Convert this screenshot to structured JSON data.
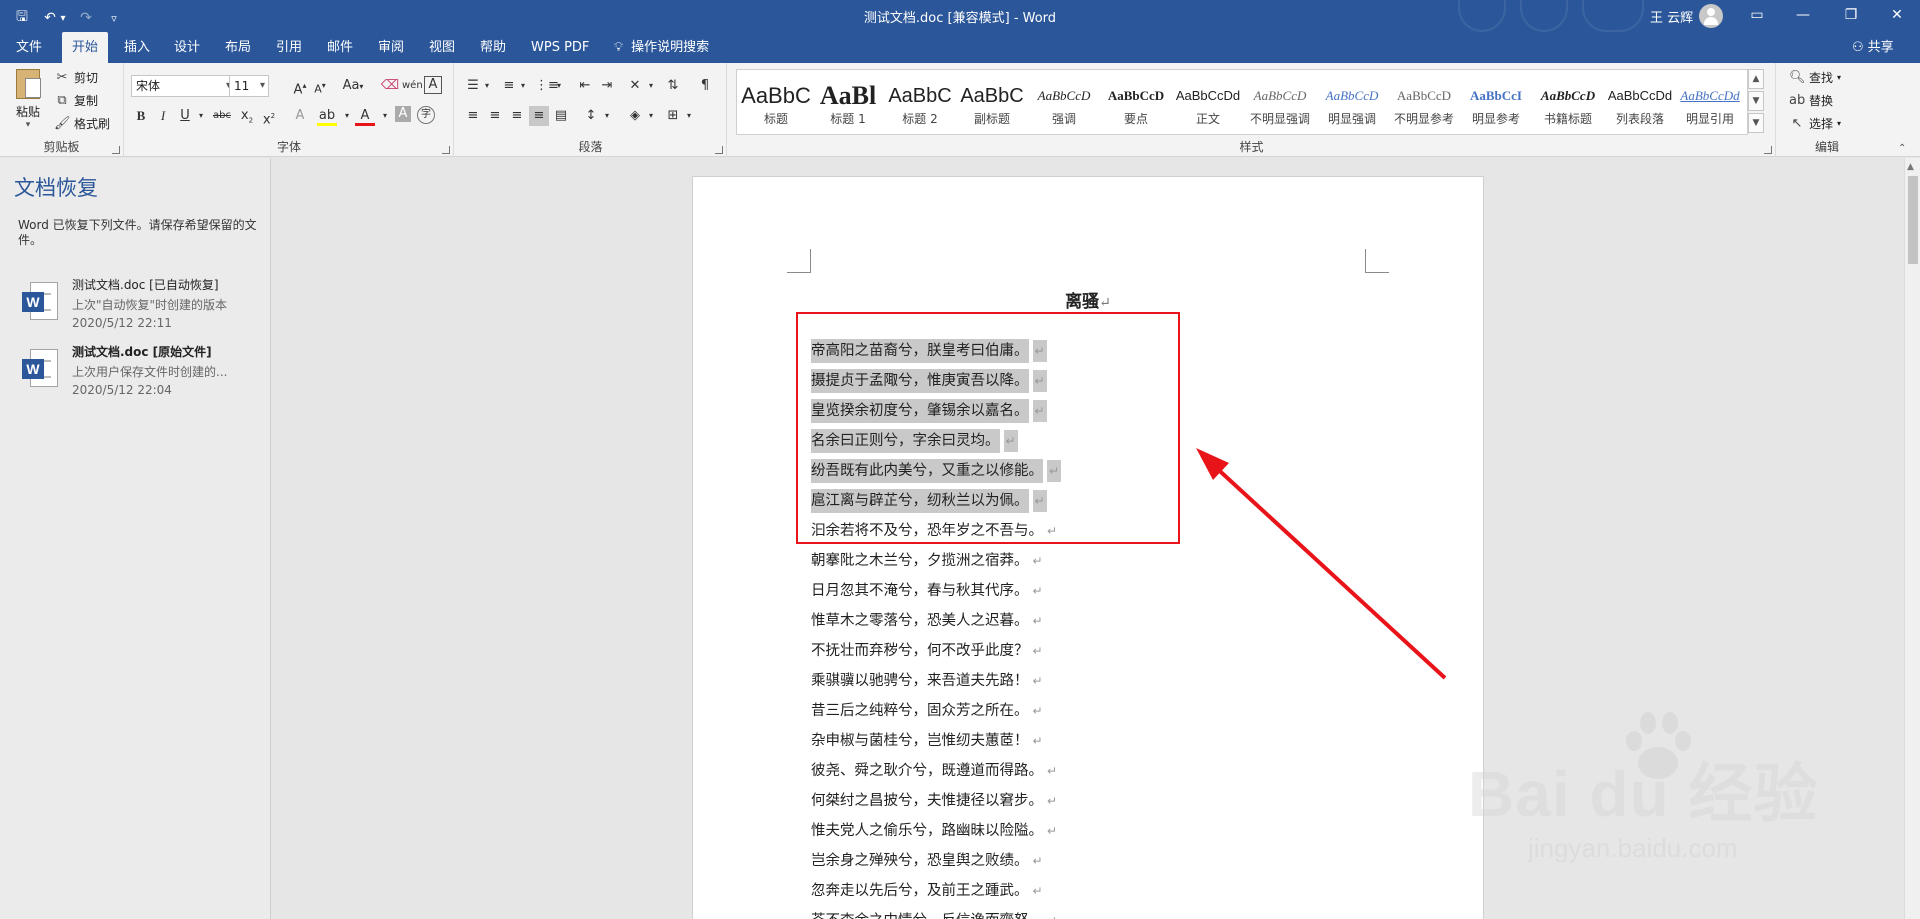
{
  "window": {
    "title": "测试文档.doc [兼容模式]  -  Word",
    "user_name": "王 云辉"
  },
  "qat": {
    "save": "🖫",
    "undo": "↶",
    "undo_drop": "▾",
    "redo": "↷",
    "customize": "▿"
  },
  "window_controls": {
    "ribbon_options": "▭",
    "minimize": "—",
    "restore": "❐",
    "close": "✕"
  },
  "tabs": [
    {
      "label": "文件"
    },
    {
      "label": "开始"
    },
    {
      "label": "插入"
    },
    {
      "label": "设计"
    },
    {
      "label": "布局"
    },
    {
      "label": "引用"
    },
    {
      "label": "邮件"
    },
    {
      "label": "审阅"
    },
    {
      "label": "视图"
    },
    {
      "label": "帮助"
    },
    {
      "label": "WPS PDF"
    },
    {
      "label": "操作说明搜索"
    }
  ],
  "active_tab": "开始",
  "share_label": "共享",
  "ribbon": {
    "clipboard": {
      "label": "剪贴板",
      "paste": "粘贴",
      "cut": "剪切",
      "copy": "复制",
      "format_painter": "格式刷"
    },
    "font": {
      "label": "字体",
      "font_name": "宋体",
      "font_size": "11",
      "change_case": "Aa"
    },
    "paragraph": {
      "label": "段落"
    },
    "styles": {
      "label": "样式",
      "items": [
        {
          "sample": "AaBbC",
          "name": "标题"
        },
        {
          "sample": "AaBl",
          "name": "标题 1"
        },
        {
          "sample": "AaBbC",
          "name": "标题 2"
        },
        {
          "sample": "AaBbC",
          "name": "副标题"
        },
        {
          "sample": "AaBbCcD",
          "name": "强调"
        },
        {
          "sample": "AaBbCcD",
          "name": "要点"
        },
        {
          "sample": "AaBbCcDd",
          "name": "正文"
        },
        {
          "sample": "AaBbCcD",
          "name": "不明显强调"
        },
        {
          "sample": "AaBbCcD",
          "name": "明显强调"
        },
        {
          "sample": "AaBbCcD",
          "name": "不明显参考"
        },
        {
          "sample": "AaBbCcI",
          "name": "明显参考"
        },
        {
          "sample": "AaBbCcD",
          "name": "书籍标题"
        },
        {
          "sample": "AaBbCcDd",
          "name": "列表段落"
        },
        {
          "sample": "AaBbCcDd",
          "name": "明显引用"
        }
      ]
    },
    "editing": {
      "label": "编辑",
      "find": "查找",
      "replace": "替换",
      "select": "选择"
    }
  },
  "recovery": {
    "title": "文档恢复",
    "description": "Word 已恢复下列文件。请保存希望保留的文件。",
    "items": [
      {
        "name": "测试文档.doc  [已自动恢复]",
        "sub": "上次\"自动恢复\"时创建的版本",
        "time": "2020/5/12 22:11"
      },
      {
        "name": "测试文档.doc  [原始文件]",
        "sub": "上次用户保存文件时创建的...",
        "time": "2020/5/12 22:04"
      }
    ]
  },
  "document": {
    "title": "离骚",
    "paragraph_mark": "↵",
    "lines": [
      {
        "text": "帝高阳之苗裔兮，朕皇考曰伯庸。",
        "selected": true
      },
      {
        "text": "摄提贞于孟陬兮，惟庚寅吾以降。",
        "selected": true
      },
      {
        "text": "皇览揆余初度兮，肇锡余以嘉名。",
        "selected": true
      },
      {
        "text": "名余曰正则兮，字余曰灵均。",
        "selected": true
      },
      {
        "text": "纷吾既有此内美兮，又重之以修能。",
        "selected": true
      },
      {
        "text": "扈江离与辟芷兮，纫秋兰以为佩。",
        "selected": true
      },
      {
        "text": "汩余若将不及兮，恐年岁之不吾与。",
        "selected": false
      },
      {
        "text": "朝搴阰之木兰兮，夕揽洲之宿莽。",
        "selected": false
      },
      {
        "text": "日月忽其不淹兮，春与秋其代序。",
        "selected": false
      },
      {
        "text": "惟草木之零落兮，恐美人之迟暮。",
        "selected": false
      },
      {
        "text": "不抚壮而弃秽兮，何不改乎此度？",
        "selected": false
      },
      {
        "text": "乘骐骥以驰骋兮，来吾道夫先路！",
        "selected": false
      },
      {
        "text": "昔三后之纯粹兮，固众芳之所在。",
        "selected": false
      },
      {
        "text": "杂申椒与菌桂兮，岂惟纫夫蕙茝！",
        "selected": false
      },
      {
        "text": "彼尧、舜之耿介兮，既遵道而得路。",
        "selected": false
      },
      {
        "text": "何桀纣之昌披兮，夫惟捷径以窘步。",
        "selected": false
      },
      {
        "text": "惟夫党人之偷乐兮，路幽昧以险隘。",
        "selected": false
      },
      {
        "text": "岂余身之殚殃兮，恐皇舆之败绩。",
        "selected": false
      },
      {
        "text": "忽奔走以先后兮，及前王之踵武。",
        "selected": false
      },
      {
        "text": "荃不查余之中情兮，反信谗而齌怒。",
        "selected": false
      }
    ]
  },
  "watermark": {
    "brand": "Bai du 经验",
    "site": "jingyan.baidu.com"
  },
  "colors": {
    "accent": "#2b579a",
    "highlight_box": "#e8141a",
    "selection": "#c9c9c9"
  }
}
